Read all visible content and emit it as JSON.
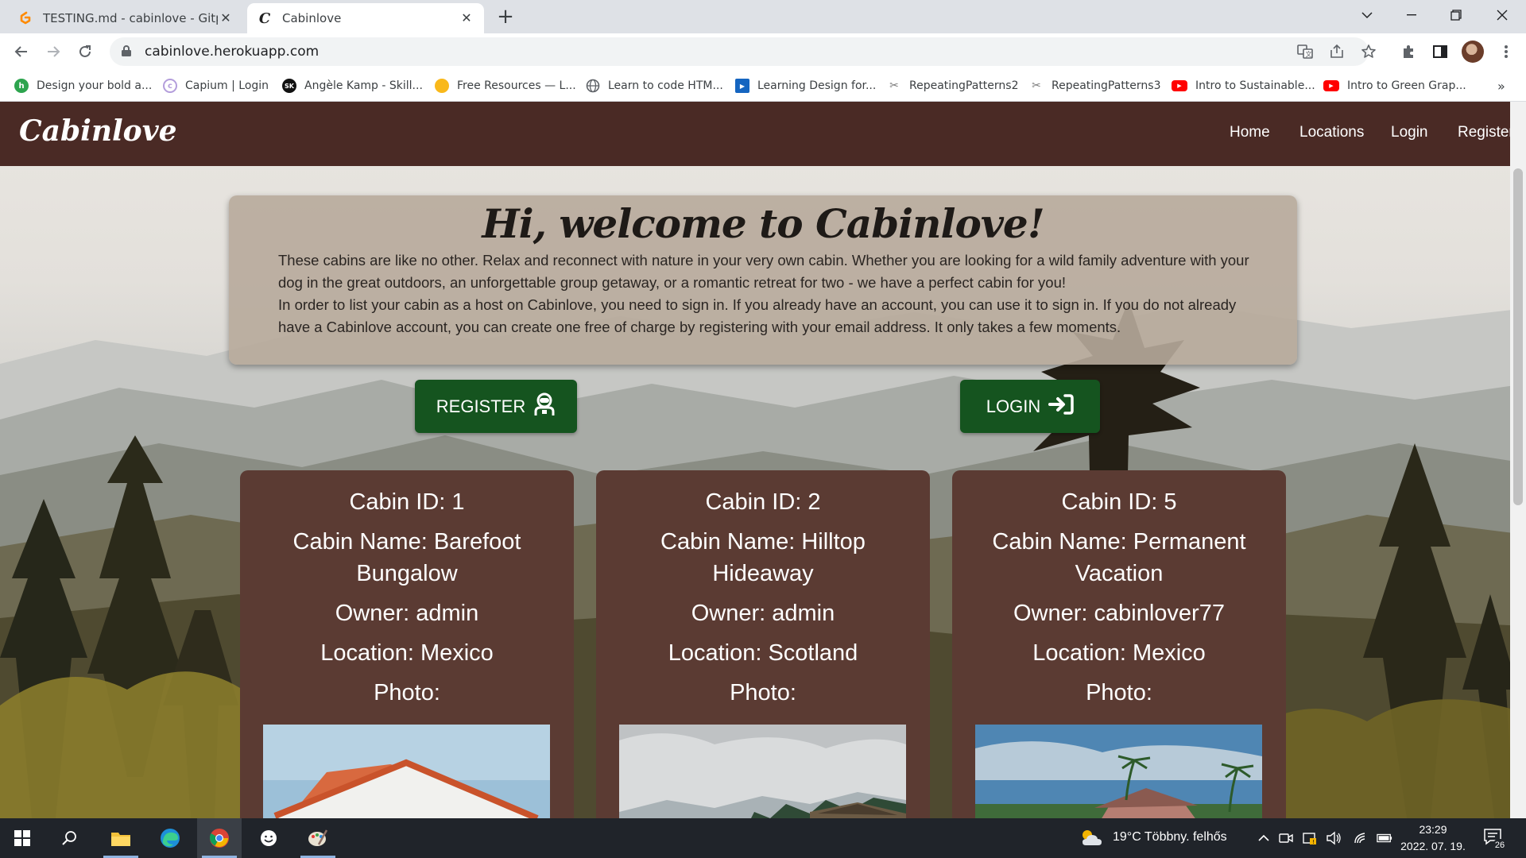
{
  "browser": {
    "tabs": [
      {
        "title": "TESTING.md - cabinlove - Gitpod",
        "active": false
      },
      {
        "title": "Cabinlove",
        "active": true
      }
    ],
    "url": "cabinlove.herokuapp.com",
    "bookmarks": [
      {
        "label": "Design your bold a...",
        "icon": "green-h-icon",
        "color": "#2da44e"
      },
      {
        "label": "Capium | Login",
        "icon": "capium-icon",
        "color": "#b39ddb"
      },
      {
        "label": "Angèle Kamp - Skill...",
        "icon": "sk-icon",
        "color": "#111111"
      },
      {
        "label": "Free Resources — L...",
        "icon": "yellow-dot-icon",
        "color": "#f9b81a"
      },
      {
        "label": "Learn to code HTM...",
        "icon": "globe-icon",
        "color": "#5f6368"
      },
      {
        "label": "Learning Design for...",
        "icon": "play-icon",
        "color": "#1565c0"
      },
      {
        "label": "RepeatingPatterns2",
        "icon": "person-icon",
        "color": "#777777"
      },
      {
        "label": "RepeatingPatterns3",
        "icon": "person-icon",
        "color": "#777777"
      },
      {
        "label": "Intro to Sustainable...",
        "icon": "youtube-icon",
        "color": "#ff0000"
      },
      {
        "label": "Intro to Green Grap...",
        "icon": "youtube-icon",
        "color": "#ff0000"
      }
    ],
    "more_bookmarks": "»"
  },
  "site": {
    "brand": "Cabinlove",
    "nav": [
      "Home",
      "Locations",
      "Login",
      "Register"
    ],
    "welcome_title": "Hi, welcome to Cabinlove!",
    "welcome_p1": "These cabins are like no other. Relax and reconnect with nature in your very own cabin. Whether you are looking for a wild family adventure with your dog in the great outdoors, an unforgettable group getaway, or a romantic retreat for two - we have a perfect cabin for you!",
    "welcome_p2": "In order to list your cabin as a host on Cabinlove, you need to sign in. If you already have an account, you can use it to sign in. If you do not already have a Cabinlove account, you can create one free of charge by registering with your email address. It only takes a few moments.",
    "register_button": "REGISTER",
    "login_button": "LOGIN",
    "accent_green": "#15541f",
    "navbar_color": "#4a2a25",
    "card_color": "#5b3b33"
  },
  "cabins": [
    {
      "id_line": "Cabin ID: 1",
      "name_line1": "Cabin Name: Barefoot",
      "name_line2": "Bungalow",
      "owner": "Owner: admin",
      "location": "Location: Mexico",
      "photo_label": "Photo:"
    },
    {
      "id_line": "Cabin ID: 2",
      "name_line1": "Cabin Name: Hilltop",
      "name_line2": "Hideaway",
      "owner": "Owner: admin",
      "location": "Location: Scotland",
      "photo_label": "Photo:"
    },
    {
      "id_line": "Cabin ID: 5",
      "name_line1": "Cabin Name: Permanent",
      "name_line2": "Vacation",
      "owner": "Owner: cabinlover77",
      "location": "Location: Mexico",
      "photo_label": "Photo:"
    }
  ],
  "taskbar": {
    "weather": "19°C  Többny. felhős",
    "time": "23:29",
    "date": "2022. 07. 19.",
    "notifications": "26"
  }
}
